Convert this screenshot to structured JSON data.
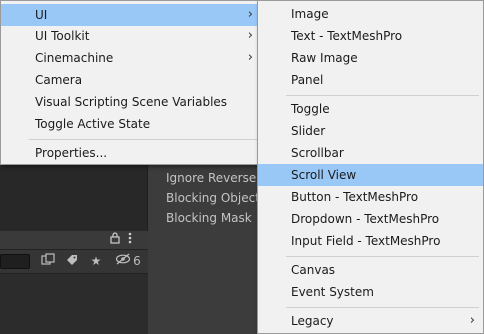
{
  "inspector": {
    "properties": [
      "Ignore Reversed",
      "Blocking Object",
      "Blocking Mask"
    ]
  },
  "hierarchy_panel": {
    "header_icons": [
      "lock-icon",
      "kebab-menu-icon"
    ],
    "toolbar_icons": [
      "scene-view-icon",
      "tag-icon",
      "star-icon",
      "hidden-icon"
    ],
    "hidden_count": "6"
  },
  "main_menu": {
    "items": [
      {
        "label": "UI",
        "submenu": true,
        "highlighted": true
      },
      {
        "label": "UI Toolkit",
        "submenu": true
      },
      {
        "label": "Cinemachine",
        "submenu": true
      },
      {
        "label": "Camera"
      },
      {
        "label": "Visual Scripting Scene Variables"
      },
      {
        "label": "Toggle Active State"
      },
      {
        "label": "Properties..."
      }
    ]
  },
  "ui_submenu": {
    "items": [
      {
        "label": "Image"
      },
      {
        "label": "Text - TextMeshPro"
      },
      {
        "label": "Raw Image"
      },
      {
        "label": "Panel"
      },
      {
        "label": "Toggle"
      },
      {
        "label": "Slider"
      },
      {
        "label": "Scrollbar"
      },
      {
        "label": "Scroll View",
        "highlighted": true
      },
      {
        "label": "Button - TextMeshPro"
      },
      {
        "label": "Dropdown - TextMeshPro"
      },
      {
        "label": "Input Field - TextMeshPro"
      },
      {
        "label": "Canvas"
      },
      {
        "label": "Event System"
      },
      {
        "label": "Legacy",
        "submenu": true
      }
    ]
  },
  "colors": {
    "menu_bg": "#f1f1f1",
    "highlight": "#99c8f7",
    "editor_bg": "#383838"
  }
}
